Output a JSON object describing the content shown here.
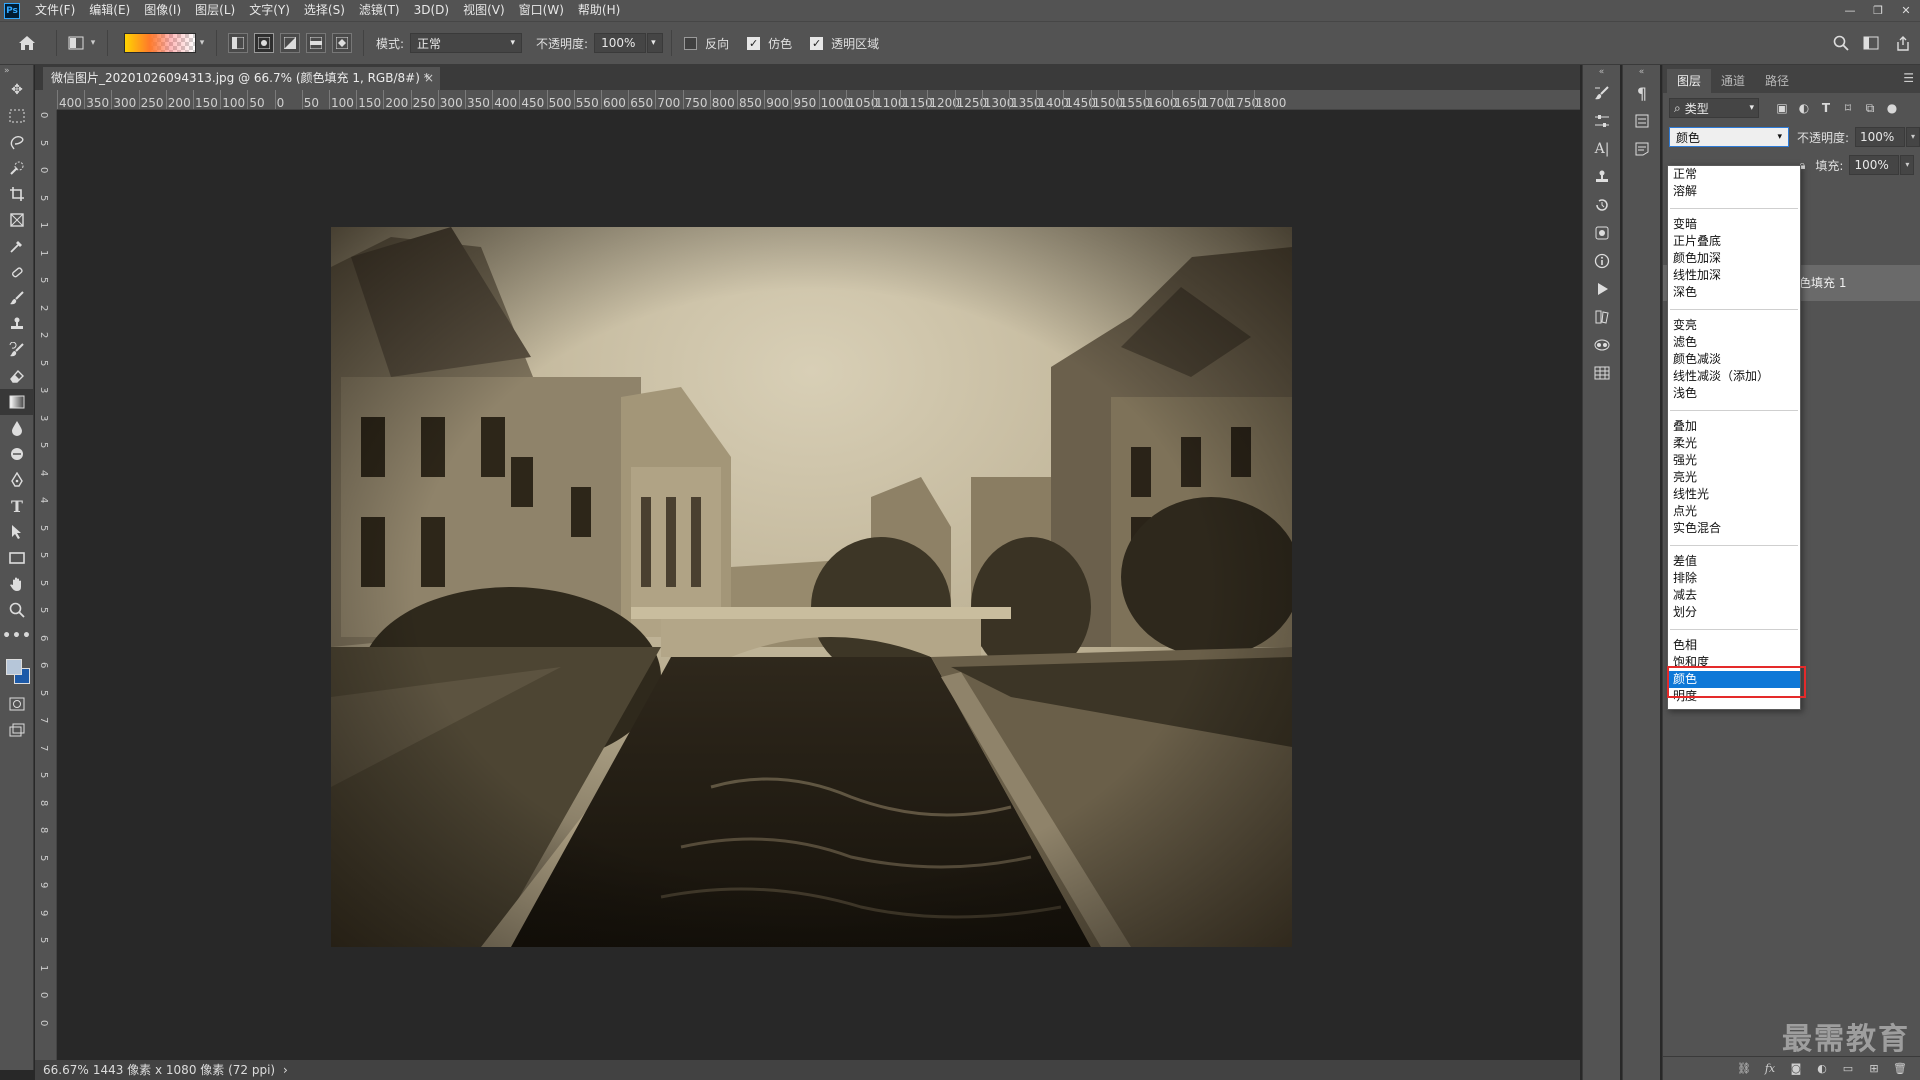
{
  "menubar": {
    "logo": "Ps",
    "items": [
      "文件(F)",
      "编辑(E)",
      "图像(I)",
      "图层(L)",
      "文字(Y)",
      "选择(S)",
      "滤镜(T)",
      "3D(D)",
      "视图(V)",
      "窗口(W)",
      "帮助(H)"
    ]
  },
  "options": {
    "mode_label": "模式:",
    "mode_value": "正常",
    "opacity_label": "不透明度:",
    "opacity_value": "100%",
    "reverse_label": "反向",
    "reverse_checked": false,
    "dither_label": "仿色",
    "dither_checked": true,
    "transparency_label": "透明区域",
    "transparency_checked": true
  },
  "document": {
    "tab_title": "微信图片_20201026094313.jpg @ 66.7% (颜色填充 1, RGB/8#) *",
    "close": "×"
  },
  "ruler_top_labels": [
    "400",
    "350",
    "300",
    "250",
    "200",
    "150",
    "100",
    "50",
    "0",
    "50",
    "100",
    "150",
    "200",
    "250",
    "300",
    "350",
    "400",
    "450",
    "500",
    "550",
    "600",
    "650",
    "700",
    "750",
    "800",
    "850",
    "900",
    "950",
    "1000",
    "1050",
    "1100",
    "1150",
    "1200",
    "1250",
    "1300",
    "1350",
    "1400",
    "1450",
    "1500",
    "1550",
    "1600",
    "1650",
    "1700",
    "1750",
    "1800"
  ],
  "ruler_left_labels": [
    "0",
    "5",
    "0",
    "5",
    "1",
    "1",
    "5",
    "2",
    "2",
    "5",
    "3",
    "3",
    "5",
    "4",
    "4",
    "5",
    "5",
    "5",
    "5",
    "6",
    "6",
    "5",
    "7",
    "7",
    "5",
    "8",
    "8",
    "5",
    "9",
    "9",
    "5",
    "1",
    "0",
    "0"
  ],
  "status": {
    "zoom": "66.67%",
    "info": "1443 像素 x 1080 像素 (72 ppi)",
    "arrow": "›"
  },
  "layers_panel": {
    "tabs": [
      "图层",
      "通道",
      "路径"
    ],
    "active_tab": "图层",
    "filter_label": "类型",
    "blend_mode_value": "颜色",
    "opacity_label": "不透明度:",
    "opacity_value": "100%",
    "fill_label": "填充:",
    "fill_value": "100%",
    "layer_name": "色填充 1"
  },
  "blend_dropdown": {
    "groups": [
      [
        "正常",
        "溶解"
      ],
      [
        "变暗",
        "正片叠底",
        "颜色加深",
        "线性加深",
        "深色"
      ],
      [
        "变亮",
        "滤色",
        "颜色减淡",
        "线性减淡（添加）",
        "浅色"
      ],
      [
        "叠加",
        "柔光",
        "强光",
        "亮光",
        "线性光",
        "点光",
        "实色混合"
      ],
      [
        "差值",
        "排除",
        "减去",
        "划分"
      ],
      [
        "色相",
        "饱和度",
        "颜色",
        "明度"
      ]
    ],
    "selected": "颜色"
  },
  "watermark": "最需教育",
  "icons": {
    "home": "home-icon",
    "search": "search-icon",
    "workspace": "workspace-icon",
    "share": "share-icon"
  },
  "colors": {
    "foreground": "#b6c6d9",
    "background": "#1d5aa8",
    "selection": "#0f78d7",
    "highlight_box": "#e42a2a"
  }
}
